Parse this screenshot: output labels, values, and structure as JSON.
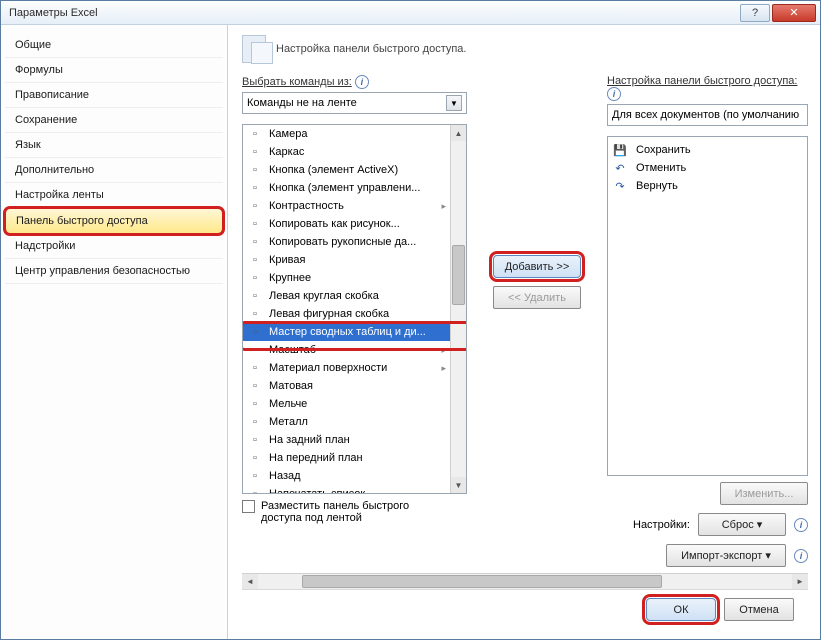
{
  "window": {
    "title": "Параметры Excel"
  },
  "sidebar": {
    "items": [
      {
        "label": "Общие"
      },
      {
        "label": "Формулы"
      },
      {
        "label": "Правописание"
      },
      {
        "label": "Сохранение"
      },
      {
        "label": "Язык"
      },
      {
        "label": "Дополнительно"
      },
      {
        "label": "Настройка ленты"
      },
      {
        "label": "Панель быстрого доступа"
      },
      {
        "label": "Надстройки"
      },
      {
        "label": "Центр управления безопасностью"
      }
    ],
    "selectedIndex": 7
  },
  "header": {
    "label": "Настройка панели быстрого доступа."
  },
  "left": {
    "pickLabel": "Выбрать команды из:",
    "dropdown": "Команды не на ленте",
    "items": [
      {
        "label": "Камера",
        "submenu": false
      },
      {
        "label": "Каркас",
        "submenu": false
      },
      {
        "label": "Кнопка (элемент ActiveX)",
        "submenu": false
      },
      {
        "label": "Кнопка (элемент управлени...",
        "submenu": false
      },
      {
        "label": "Контрастность",
        "submenu": true
      },
      {
        "label": "Копировать как рисунок...",
        "submenu": false
      },
      {
        "label": "Копировать рукописные да...",
        "submenu": false
      },
      {
        "label": "Кривая",
        "submenu": false
      },
      {
        "label": "Крупнее",
        "submenu": false
      },
      {
        "label": "Левая круглая скобка",
        "submenu": false
      },
      {
        "label": "Левая фигурная скобка",
        "submenu": false
      },
      {
        "label": "Мастер сводных таблиц и ди...",
        "submenu": false,
        "selected": true
      },
      {
        "label": "Масштаб",
        "submenu": true
      },
      {
        "label": "Материал поверхности",
        "submenu": true
      },
      {
        "label": "Матовая",
        "submenu": false
      },
      {
        "label": "Мельче",
        "submenu": false
      },
      {
        "label": "Металл",
        "submenu": false
      },
      {
        "label": "На задний план",
        "submenu": false
      },
      {
        "label": "На передний план",
        "submenu": false
      },
      {
        "label": "Назад",
        "submenu": false
      },
      {
        "label": "Напечатать список",
        "submenu": false
      }
    ],
    "checkbox": "Разместить панель быстрого доступа под лентой"
  },
  "mid": {
    "add": "Добавить >>",
    "remove": "<< Удалить"
  },
  "right": {
    "pickLabel": "Настройка панели быстрого доступа:",
    "dropdown": "Для всех документов (по умолчанию",
    "items": [
      {
        "label": "Сохранить",
        "icon": "save"
      },
      {
        "label": "Отменить",
        "icon": "undo"
      },
      {
        "label": "Вернуть",
        "icon": "redo"
      }
    ],
    "modify": "Изменить...",
    "settingsLabel": "Настройки:",
    "reset": "Сброс ▾",
    "import": "Импорт-экспорт ▾"
  },
  "footer": {
    "ok": "ОК",
    "cancel": "Отмена"
  }
}
